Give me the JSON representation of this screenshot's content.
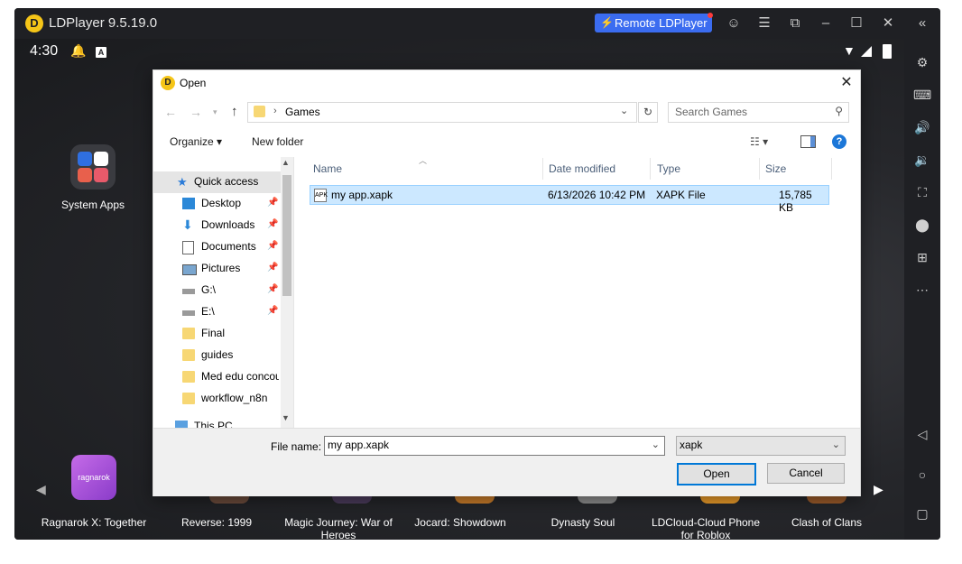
{
  "window": {
    "title": "LDPlayer 9.5.19.0",
    "logo_letter": "D",
    "remote_button": "Remote LDPlayer",
    "accent": "#3b6cf0"
  },
  "status_bar": {
    "time": "4:30",
    "a_badge": "A"
  },
  "home": {
    "system_apps_label": "System Apps",
    "games": [
      "Ragnarok X: Together",
      "Reverse: 1999",
      "Magic Journey: War of Heroes",
      "Jocard: Showdown",
      "Dynasty Soul",
      "LDCloud-Cloud Phone for Roblox",
      "Clash of Clans"
    ],
    "ragnarok_icon_text": "ragnarok"
  },
  "right_toolbar": [
    "gear-icon",
    "keyboard-icon",
    "volume-up-icon",
    "volume-down-icon",
    "screenshot-icon",
    "apk-install-icon",
    "multi-instance-icon",
    "more-icon",
    "back-icon",
    "home-icon",
    "recents-icon"
  ],
  "dialog": {
    "title": "Open",
    "address": {
      "current": "Games"
    },
    "search_placeholder": "Search Games",
    "toolbar": {
      "organize": "Organize",
      "new_folder": "New folder"
    },
    "nav": [
      {
        "label": "Quick access",
        "icon": "star-icon",
        "selected": true
      },
      {
        "label": "Desktop",
        "icon": "desktop-icon",
        "pinned": true
      },
      {
        "label": "Downloads",
        "icon": "downloads-icon",
        "pinned": true
      },
      {
        "label": "Documents",
        "icon": "documents-icon",
        "pinned": true
      },
      {
        "label": "Pictures",
        "icon": "pictures-icon",
        "pinned": true
      },
      {
        "label": "G:\\",
        "icon": "drive-icon",
        "pinned": true
      },
      {
        "label": "E:\\",
        "icon": "drive-icon",
        "pinned": true
      },
      {
        "label": "Final",
        "icon": "folder-icon"
      },
      {
        "label": "guides",
        "icon": "folder-icon"
      },
      {
        "label": "Med edu concou",
        "icon": "folder-icon"
      },
      {
        "label": "workflow_n8n",
        "icon": "folder-icon"
      },
      {
        "label": "This PC",
        "icon": "pc-icon"
      }
    ],
    "columns": {
      "name": "Name",
      "date": "Date modified",
      "type": "Type",
      "size": "Size"
    },
    "files": [
      {
        "name": "my app.xapk",
        "date": "6/13/2026 10:42 PM",
        "type": "XAPK File",
        "size": "15,785 KB",
        "icon_text": "APK"
      }
    ],
    "file_name_label": "File name:",
    "file_name_value": "my app.xapk",
    "file_type": "xapk",
    "open_button": "Open",
    "cancel_button": "Cancel"
  }
}
